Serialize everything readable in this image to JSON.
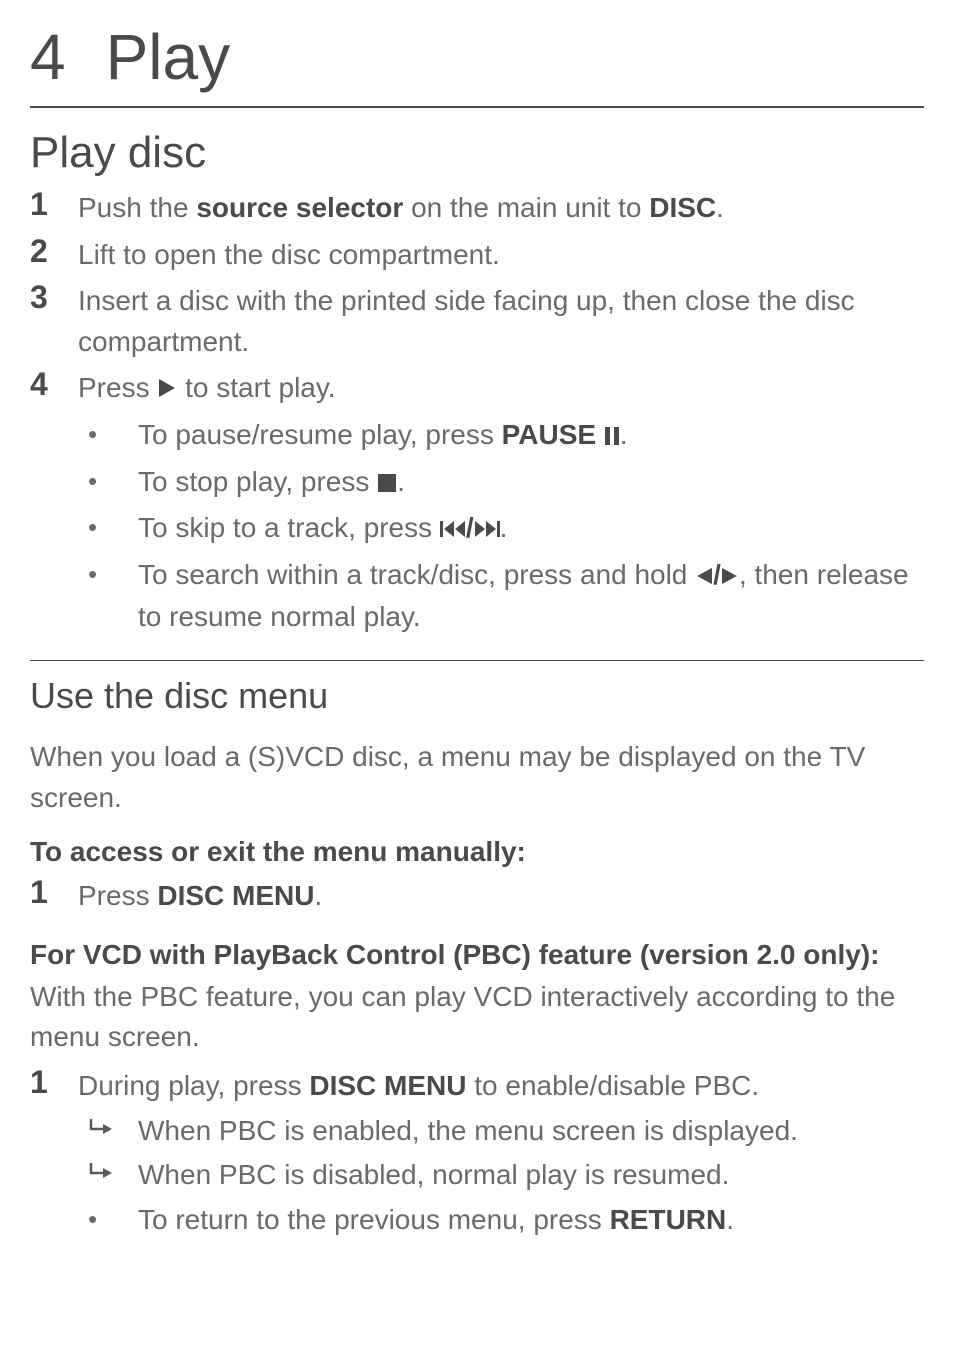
{
  "chapter": {
    "number": "4",
    "title": "Play"
  },
  "section1": {
    "title": "Play disc",
    "steps": {
      "s1": {
        "num": "1",
        "pre": "Push the ",
        "bold1": "source selector",
        "mid": " on the main unit to ",
        "bold2": "DISC",
        "post": "."
      },
      "s2": {
        "num": "2",
        "text": "Lift to open the disc compartment."
      },
      "s3": {
        "num": "3",
        "text": "Insert a disc with the printed side facing up, then close the disc compartment."
      },
      "s4": {
        "num": "4",
        "pre": "Press ",
        "post": " to start play."
      }
    },
    "subbullets": {
      "b1": {
        "pre": "To pause/resume play, press ",
        "bold": "PAUSE",
        "post": "."
      },
      "b2": {
        "pre": "To stop play, press ",
        "post": "."
      },
      "b3": {
        "pre": "To skip to a track, press ",
        "post": "."
      },
      "b4": {
        "pre": "To search within a track/disc, press and hold ",
        "mid": ", then release to resume normal play."
      }
    }
  },
  "section2": {
    "title": "Use the disc menu",
    "intro": "When you load a (S)VCD disc, a menu may be displayed on the TV screen.",
    "label1": "To access or exit the menu manually:",
    "step1": {
      "num": "1",
      "pre": "Press ",
      "bold": "DISC MENU",
      "post": "."
    },
    "label2": "For VCD with PlayBack Control (PBC) feature (version 2.0 only):",
    "pbc_intro": "With the PBC feature, you can play VCD interactively according to the menu screen.",
    "pbc_step": {
      "num": "1",
      "pre": "During play, press ",
      "bold": "DISC MENU",
      "post": " to enable/disable PBC."
    },
    "arrows": {
      "a1": "When PBC is enabled, the menu screen is displayed.",
      "a2": "When PBC is disabled, normal play is resumed."
    },
    "return_bullet": {
      "pre": "To return to the previous menu, press ",
      "bold": "RETURN",
      "post": "."
    }
  }
}
